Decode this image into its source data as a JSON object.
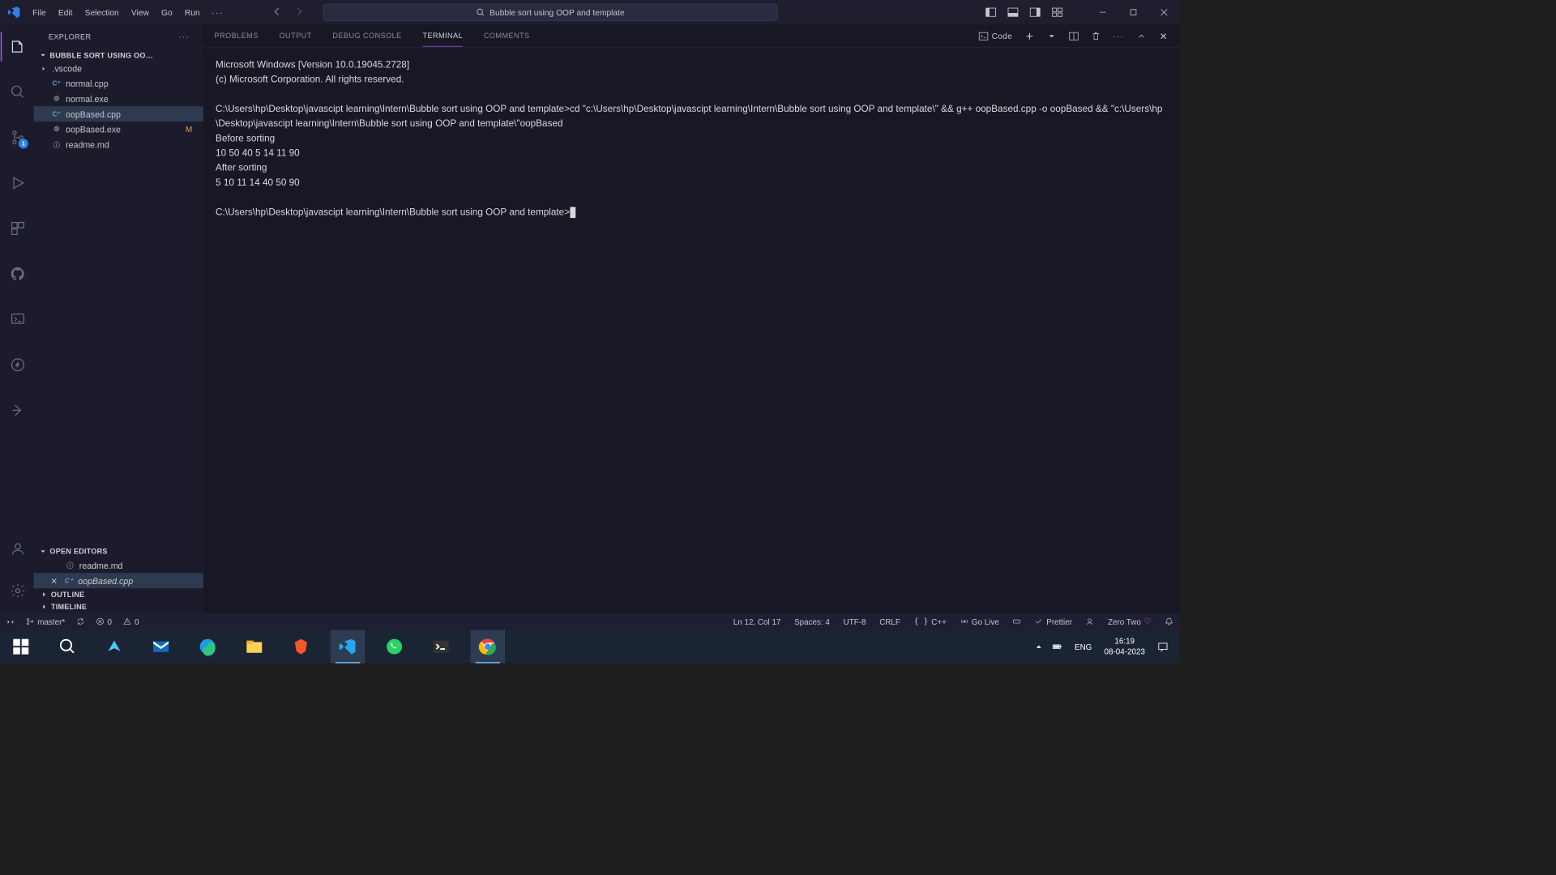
{
  "window": {
    "title": "Bubble sort using OOP and template"
  },
  "menubar": {
    "items": [
      "File",
      "Edit",
      "Selection",
      "View",
      "Go",
      "Run"
    ],
    "more": "···"
  },
  "sidebar": {
    "title": "EXPLORER",
    "folderName": "BUBBLE SORT USING OO…",
    "files": [
      {
        "name": ".vscode",
        "type": "folder"
      },
      {
        "name": "normal.cpp",
        "type": "cpp"
      },
      {
        "name": "normal.exe",
        "type": "exe"
      },
      {
        "name": "oopBased.cpp",
        "type": "cpp",
        "active": true
      },
      {
        "name": "oopBased.exe",
        "type": "exe",
        "badge": "M"
      },
      {
        "name": "readme.md",
        "type": "md"
      }
    ],
    "openEditorsLabel": "OPEN EDITORS",
    "openEditors": [
      {
        "name": "readme.md",
        "type": "md"
      },
      {
        "name": "oopBased.cpp",
        "type": "cpp",
        "active": true
      }
    ],
    "outlineLabel": "OUTLINE",
    "timelineLabel": "TIMELINE"
  },
  "panel": {
    "tabs": [
      "PROBLEMS",
      "OUTPUT",
      "DEBUG CONSOLE",
      "TERMINAL",
      "COMMENTS"
    ],
    "activeTab": "TERMINAL",
    "codeLabel": "Code"
  },
  "terminal": {
    "lines": [
      "Microsoft Windows [Version 10.0.19045.2728]",
      "(c) Microsoft Corporation. All rights reserved.",
      "",
      "C:\\Users\\hp\\Desktop\\javascipt learning\\Intern\\Bubble sort using OOP and template>cd \"c:\\Users\\hp\\Desktop\\javascipt learning\\Intern\\Bubble sort using OOP and template\\\" && g++ oopBased.cpp -o oopBased && \"c:\\Users\\hp\\Desktop\\javascipt learning\\Intern\\Bubble sort using OOP and template\\\"oopBased",
      "Before sorting",
      "10 50 40 5 14 11 90",
      "After sorting",
      "5 10 11 14 40 50 90",
      "",
      "C:\\Users\\hp\\Desktop\\javascipt learning\\Intern\\Bubble sort using OOP and template>"
    ]
  },
  "status": {
    "remote": "",
    "branch": "master*",
    "errors": "0",
    "warnings": "0",
    "lineCol": "Ln 12, Col 17",
    "spaces": "Spaces: 4",
    "encoding": "UTF-8",
    "eol": "CRLF",
    "language": "C++",
    "goLive": "Go Live",
    "prettier": "Prettier",
    "zeroTwo": "Zero Two"
  },
  "scm": {
    "badge": "1"
  },
  "taskbar": {
    "lang": "ENG",
    "time": "16:19",
    "date": "08-04-2023"
  }
}
